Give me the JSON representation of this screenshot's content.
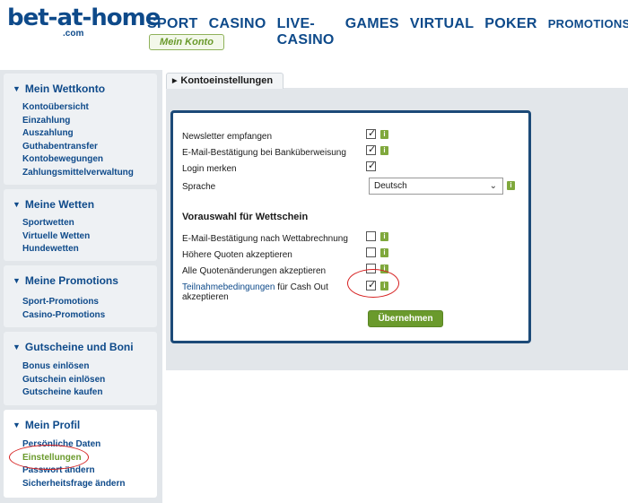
{
  "logo": {
    "main": "bet-at-home",
    "sub": ".com"
  },
  "topnav": [
    "SPORT",
    "CASINO",
    "LIVE-CASINO",
    "GAMES",
    "VIRTUAL",
    "POKER",
    "PROMOTIONS"
  ],
  "mein_konto": "Mein Konto",
  "sidebar": {
    "sections": [
      {
        "title": "Mein Wettkonto",
        "items": [
          "Kontoübersicht",
          "Einzahlung",
          "Auszahlung",
          "Guthabentransfer",
          "Kontobewegungen",
          "Zahlungsmittelverwaltung"
        ]
      },
      {
        "title": "Meine Wetten",
        "items": [
          "Sportwetten",
          "Virtuelle Wetten",
          "Hundewetten"
        ]
      },
      {
        "title": "Meine Promotions",
        "items": [
          "Sport-Promotions",
          "Casino-Promotions"
        ]
      },
      {
        "title": "Gutscheine und Boni",
        "items": [
          "Bonus einlösen",
          "Gutschein einlösen",
          "Gutscheine kaufen"
        ]
      },
      {
        "title": "Mein Profil",
        "items": [
          "Persönliche Daten",
          "Einstellungen",
          "Passwort ändern",
          "Sicherheitsfrage ändern"
        ]
      }
    ]
  },
  "tab": {
    "label": "Kontoeinstellungen"
  },
  "settings": {
    "newsletter": {
      "label": "Newsletter empfangen",
      "checked": true
    },
    "email_bank": {
      "label": "E-Mail-Bestätigung bei Banküberweisung",
      "checked": true
    },
    "login_merken": {
      "label": "Login merken",
      "checked": true
    },
    "sprache": {
      "label": "Sprache",
      "value": "Deutsch"
    },
    "section_title": "Vorauswahl für Wettschein",
    "email_wett": {
      "label": "E-Mail-Bestätigung nach Wettabrechnung",
      "checked": false
    },
    "hoehere_quoten": {
      "label": "Höhere Quoten akzeptieren",
      "checked": false
    },
    "alle_quoten": {
      "label": "Alle Quotenänderungen akzeptieren",
      "checked": false
    },
    "cashout": {
      "link": "Teilnahmebedingungen",
      "text_rest": " für Cash Out",
      "line2": "akzeptieren",
      "checked": true
    },
    "submit_label": "Übernehmen",
    "info_glyph": "i",
    "tick_glyph": "✓"
  },
  "colors": {
    "brand_blue": "#0e4a8a",
    "accent_green": "#6a9a2c",
    "annotation_red": "#d62020"
  }
}
